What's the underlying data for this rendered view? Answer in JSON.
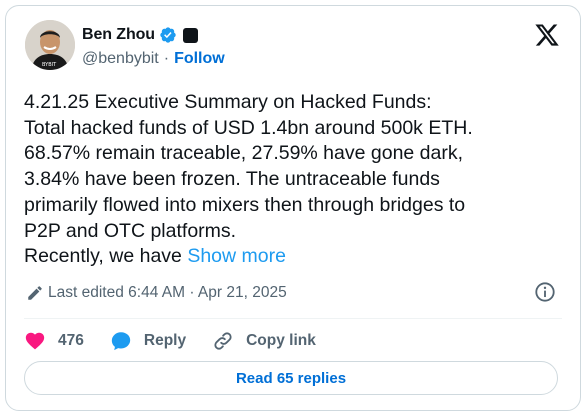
{
  "author": {
    "name": "Ben Zhou",
    "handle": "@benbybit",
    "separator": "·",
    "follow_label": "Follow",
    "verified_color": "#1d9bf0"
  },
  "tweet": {
    "lines": [
      "4.21.25 Executive Summary on Hacked Funds:",
      "Total hacked funds of USD 1.4bn around 500k ETH.",
      "68.57% remain traceable, 27.59% have gone dark,",
      "3.84% have been frozen. The untraceable funds",
      "primarily flowed into mixers then through bridges to",
      "P2P and OTC platforms."
    ],
    "last_line_prefix": "Recently, we have ",
    "show_more_label": "Show more"
  },
  "meta": {
    "edited_text": "Last edited 6:44 AM · Apr 21, 2025"
  },
  "actions": {
    "likes": "476",
    "reply_label": "Reply",
    "copy_link_label": "Copy link"
  },
  "replies_button": {
    "label": "Read 65 replies"
  },
  "colors": {
    "accent": "#1d9bf0",
    "link": "#006fd6",
    "like": "#f91880",
    "muted": "#536471"
  },
  "icons": [
    "verified-badge-icon",
    "affiliate-badge-icon",
    "x-logo-icon",
    "pencil-icon",
    "info-icon",
    "heart-icon",
    "reply-bubble-icon",
    "link-icon"
  ]
}
